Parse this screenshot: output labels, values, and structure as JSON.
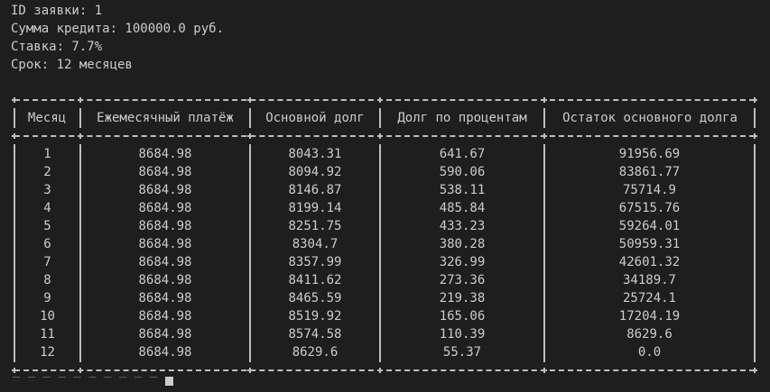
{
  "info": {
    "id_line": "ID заявки: 1",
    "amount_line": "Сумма кредита: 100000.0 руб.",
    "rate_line": "Ставка: 7.7%",
    "term_line": "Срок: 12 месяцев"
  },
  "table": {
    "headers": [
      "Месяц",
      "Ежемесячный платёж",
      "Основной долг",
      "Долг по процентам",
      "Остаток основного долга"
    ],
    "rows": [
      [
        "1",
        "8684.98",
        "8043.31",
        "641.67",
        "91956.69"
      ],
      [
        "2",
        "8684.98",
        "8094.92",
        "590.06",
        "83861.77"
      ],
      [
        "3",
        "8684.98",
        "8146.87",
        "538.11",
        "75714.9"
      ],
      [
        "4",
        "8684.98",
        "8199.14",
        "485.84",
        "67515.76"
      ],
      [
        "5",
        "8684.98",
        "8251.75",
        "433.23",
        "59264.01"
      ],
      [
        "6",
        "8684.98",
        "8304.7",
        "380.28",
        "50959.31"
      ],
      [
        "7",
        "8684.98",
        "8357.99",
        "326.99",
        "42601.32"
      ],
      [
        "8",
        "8684.98",
        "8411.62",
        "273.36",
        "34189.7"
      ],
      [
        "9",
        "8684.98",
        "8465.59",
        "219.38",
        "25724.1"
      ],
      [
        "10",
        "8684.98",
        "8519.92",
        "165.06",
        "17204.19"
      ],
      [
        "11",
        "8684.98",
        "8574.58",
        "110.39",
        "8629.6"
      ],
      [
        "12",
        "8684.98",
        "8629.6",
        "55.37",
        "0.0"
      ]
    ]
  }
}
